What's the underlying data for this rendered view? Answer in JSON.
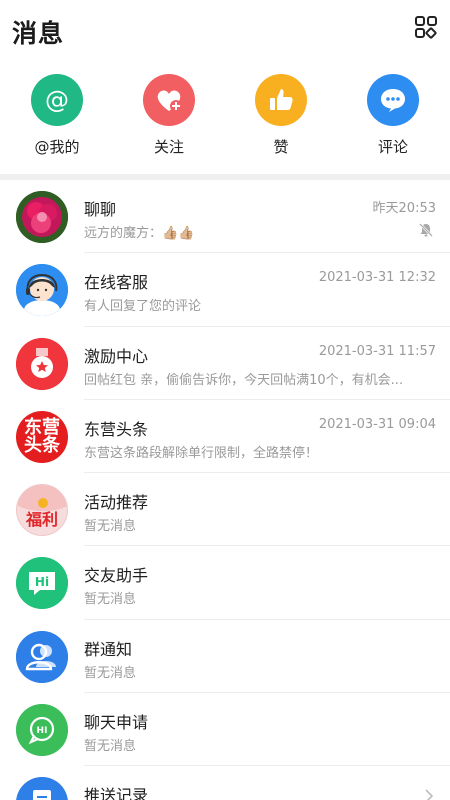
{
  "header": {
    "title": "消息",
    "grid_icon": "grid-menu-icon"
  },
  "quick": [
    {
      "label": "@我的",
      "icon": "at-icon",
      "color": "#20b885"
    },
    {
      "label": "关注",
      "icon": "heart-plus-icon",
      "color": "#f25f63"
    },
    {
      "label": "赞",
      "icon": "thumbs-up-icon",
      "color": "#f8b020"
    },
    {
      "label": "评论",
      "icon": "chat-bubble-icon",
      "color": "#2d8df1"
    }
  ],
  "messages": [
    {
      "name": "聊聊",
      "preview": "远方的魔方：👍🏼👍🏼",
      "time": "昨天20:53",
      "avatar": "flower-photo",
      "muted": true
    },
    {
      "name": "在线客服",
      "preview": "有人回复了您的评论",
      "time": "2021-03-31 12:32",
      "avatar": "support-agent-icon"
    },
    {
      "name": "激励中心",
      "preview": "回帖红包 亲，偷偷告诉你，今天回帖满10个，有机会...",
      "time": "2021-03-31 11:57",
      "avatar": "medal-icon"
    },
    {
      "name": "东营头条",
      "preview": "东营这条路段解除单行限制，全路禁停！",
      "time": "2021-03-31 09:04",
      "avatar": "dongying-headline-logo",
      "logo_text": [
        "东营",
        "头条"
      ]
    },
    {
      "name": "活动推荐",
      "preview": "暂无消息",
      "time": "",
      "avatar": "red-envelope-icon",
      "logo_text": "福利"
    },
    {
      "name": "交友助手",
      "preview": "暂无消息",
      "time": "",
      "avatar": "hi-chat-icon",
      "logo_text": "Hi"
    },
    {
      "name": "群通知",
      "preview": "暂无消息",
      "time": "",
      "avatar": "group-users-icon"
    },
    {
      "name": "聊天申请",
      "preview": "暂无消息",
      "time": "",
      "avatar": "hi-bubble-icon",
      "logo_text": "HI"
    },
    {
      "name": "推送记录",
      "preview": "",
      "time": "",
      "avatar": "document-icon"
    }
  ],
  "colors": {
    "at": "#20b885",
    "heart": "#f25f63",
    "thumb": "#f8b020",
    "chat": "#2d8df1",
    "support": "#2d8df1",
    "medal": "#f0353c",
    "headline": "#e41e1e",
    "envelope": "#f6dcdc",
    "hi": "#20c17a",
    "group": "#2e7fe8",
    "hi_bubble": "#3bbe5a",
    "doc": "#2e7fe8"
  }
}
